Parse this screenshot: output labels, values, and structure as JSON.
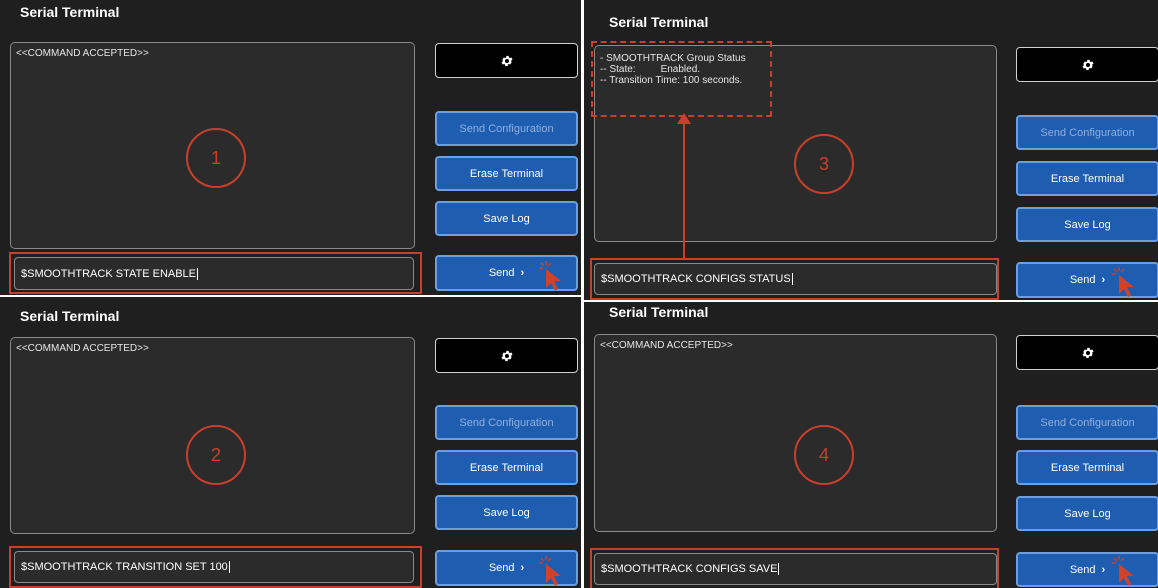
{
  "panels": [
    {
      "title": "Serial Terminal",
      "terminal_lines": "<<COMMAND ACCEPTED>>",
      "step": "1",
      "input_value": "$SMOOTHTRACK STATE ENABLE",
      "buttons": {
        "send_configuration": "Send Configuration",
        "erase_terminal": "Erase Terminal",
        "save_log": "Save Log",
        "send": "Send"
      }
    },
    {
      "title": "Serial Terminal",
      "terminal_lines": "<<COMMAND ACCEPTED>>",
      "step": "2",
      "input_value": "$SMOOTHTRACK TRANSITION SET 100",
      "buttons": {
        "send_configuration": "Send Configuration",
        "erase_terminal": "Erase Terminal",
        "save_log": "Save Log",
        "send": "Send"
      }
    },
    {
      "title": "Serial Terminal",
      "terminal_lines": "- SMOOTHTRACK Group Status\n-- State:         Enabled.\n-- Transition Time: 100 seconds.",
      "step": "3",
      "input_value": "$SMOOTHTRACK CONFIGS STATUS",
      "buttons": {
        "send_configuration": "Send Configuration",
        "erase_terminal": "Erase Terminal",
        "save_log": "Save Log",
        "send": "Send"
      }
    },
    {
      "title": "Serial Terminal",
      "terminal_lines": "<<COMMAND ACCEPTED>>",
      "step": "4",
      "input_value": "$SMOOTHTRACK CONFIGS SAVE",
      "buttons": {
        "send_configuration": "Send Configuration",
        "erase_terminal": "Erase Terminal",
        "save_log": "Save Log",
        "send": "Send"
      }
    }
  ],
  "icons": {
    "settings": "gear-icon",
    "send_arrow": "chevron-right-icon",
    "pointer": "cursor-pointer-icon"
  },
  "colors": {
    "panel_bg": "#1f1f1f",
    "terminal_bg": "#2b2b2b",
    "button_blue": "#1f5db0",
    "annotation_red": "#c9402a"
  }
}
